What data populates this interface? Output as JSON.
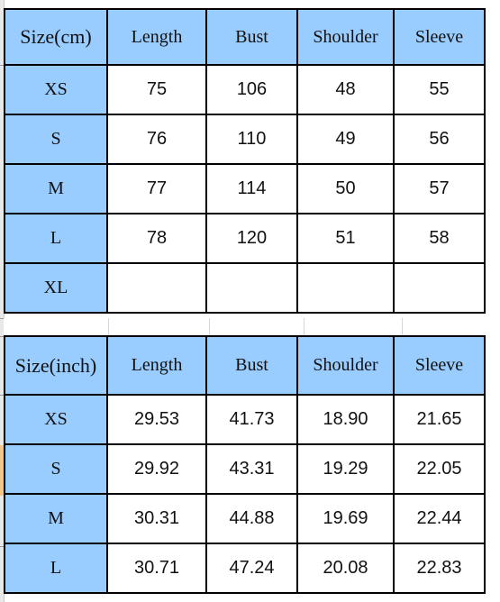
{
  "tables": {
    "cm": {
      "header": [
        "Size(cm)",
        "Length",
        "Bust",
        "Shoulder",
        "Sleeve"
      ],
      "rows": [
        {
          "size": "XS",
          "values": [
            "75",
            "106",
            "48",
            "55"
          ]
        },
        {
          "size": "S",
          "values": [
            "76",
            "110",
            "49",
            "56"
          ]
        },
        {
          "size": "M",
          "values": [
            "77",
            "114",
            "50",
            "57"
          ]
        },
        {
          "size": "L",
          "values": [
            "78",
            "120",
            "51",
            "58"
          ]
        },
        {
          "size": "XL",
          "values": [
            "",
            "",
            "",
            ""
          ]
        }
      ]
    },
    "inch": {
      "header": [
        "Size(inch)",
        "Length",
        "Bust",
        "Shoulder",
        "Sleeve"
      ],
      "rows": [
        {
          "size": "XS",
          "values": [
            "29.53",
            "41.73",
            "18.90",
            "21.65"
          ]
        },
        {
          "size": "S",
          "values": [
            "29.92",
            "43.31",
            "19.29",
            "22.05"
          ]
        },
        {
          "size": "M",
          "values": [
            "30.31",
            "44.88",
            "19.69",
            "22.44"
          ]
        },
        {
          "size": "L",
          "values": [
            "30.71",
            "47.24",
            "20.08",
            "22.83"
          ]
        }
      ]
    }
  },
  "colors": {
    "header_fill": "#99ccff",
    "grid_line": "#000000",
    "cell_fill": "#ffffff",
    "gutter_highlight": "#f5c58a"
  }
}
